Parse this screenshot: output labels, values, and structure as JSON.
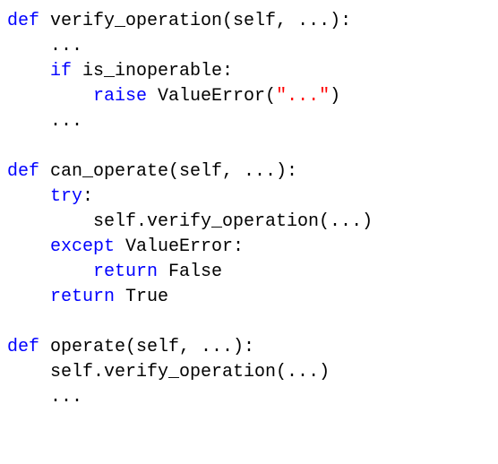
{
  "code": {
    "lines": [
      {
        "indent": 0,
        "segments": [
          {
            "cls": "kw",
            "t": "def"
          },
          {
            "t": " verify_operation(self, ...):"
          }
        ]
      },
      {
        "indent": 1,
        "segments": [
          {
            "t": "..."
          }
        ]
      },
      {
        "indent": 1,
        "segments": [
          {
            "cls": "kw",
            "t": "if"
          },
          {
            "t": " is_inoperable:"
          }
        ]
      },
      {
        "indent": 2,
        "segments": [
          {
            "cls": "kw",
            "t": "raise"
          },
          {
            "t": " ValueError("
          },
          {
            "cls": "str",
            "t": "\"...\""
          },
          {
            "t": ")"
          }
        ]
      },
      {
        "indent": 1,
        "segments": [
          {
            "t": "..."
          }
        ]
      },
      {
        "indent": 0,
        "segments": []
      },
      {
        "indent": 0,
        "segments": [
          {
            "cls": "kw",
            "t": "def"
          },
          {
            "t": " can_operate(self, ...):"
          }
        ]
      },
      {
        "indent": 1,
        "segments": [
          {
            "cls": "kw",
            "t": "try"
          },
          {
            "t": ":"
          }
        ]
      },
      {
        "indent": 2,
        "segments": [
          {
            "t": "self.verify_operation(...)"
          }
        ]
      },
      {
        "indent": 1,
        "segments": [
          {
            "cls": "kw",
            "t": "except"
          },
          {
            "t": " ValueError:"
          }
        ]
      },
      {
        "indent": 2,
        "segments": [
          {
            "cls": "kw",
            "t": "return"
          },
          {
            "t": " False"
          }
        ]
      },
      {
        "indent": 1,
        "segments": [
          {
            "cls": "kw",
            "t": "return"
          },
          {
            "t": " True"
          }
        ]
      },
      {
        "indent": 0,
        "segments": []
      },
      {
        "indent": 0,
        "segments": [
          {
            "cls": "kw",
            "t": "def"
          },
          {
            "t": " operate(self, ...):"
          }
        ]
      },
      {
        "indent": 1,
        "segments": [
          {
            "t": "self.verify_operation(...)"
          }
        ]
      },
      {
        "indent": 1,
        "segments": [
          {
            "t": "..."
          }
        ]
      }
    ],
    "indent_unit": "    "
  }
}
